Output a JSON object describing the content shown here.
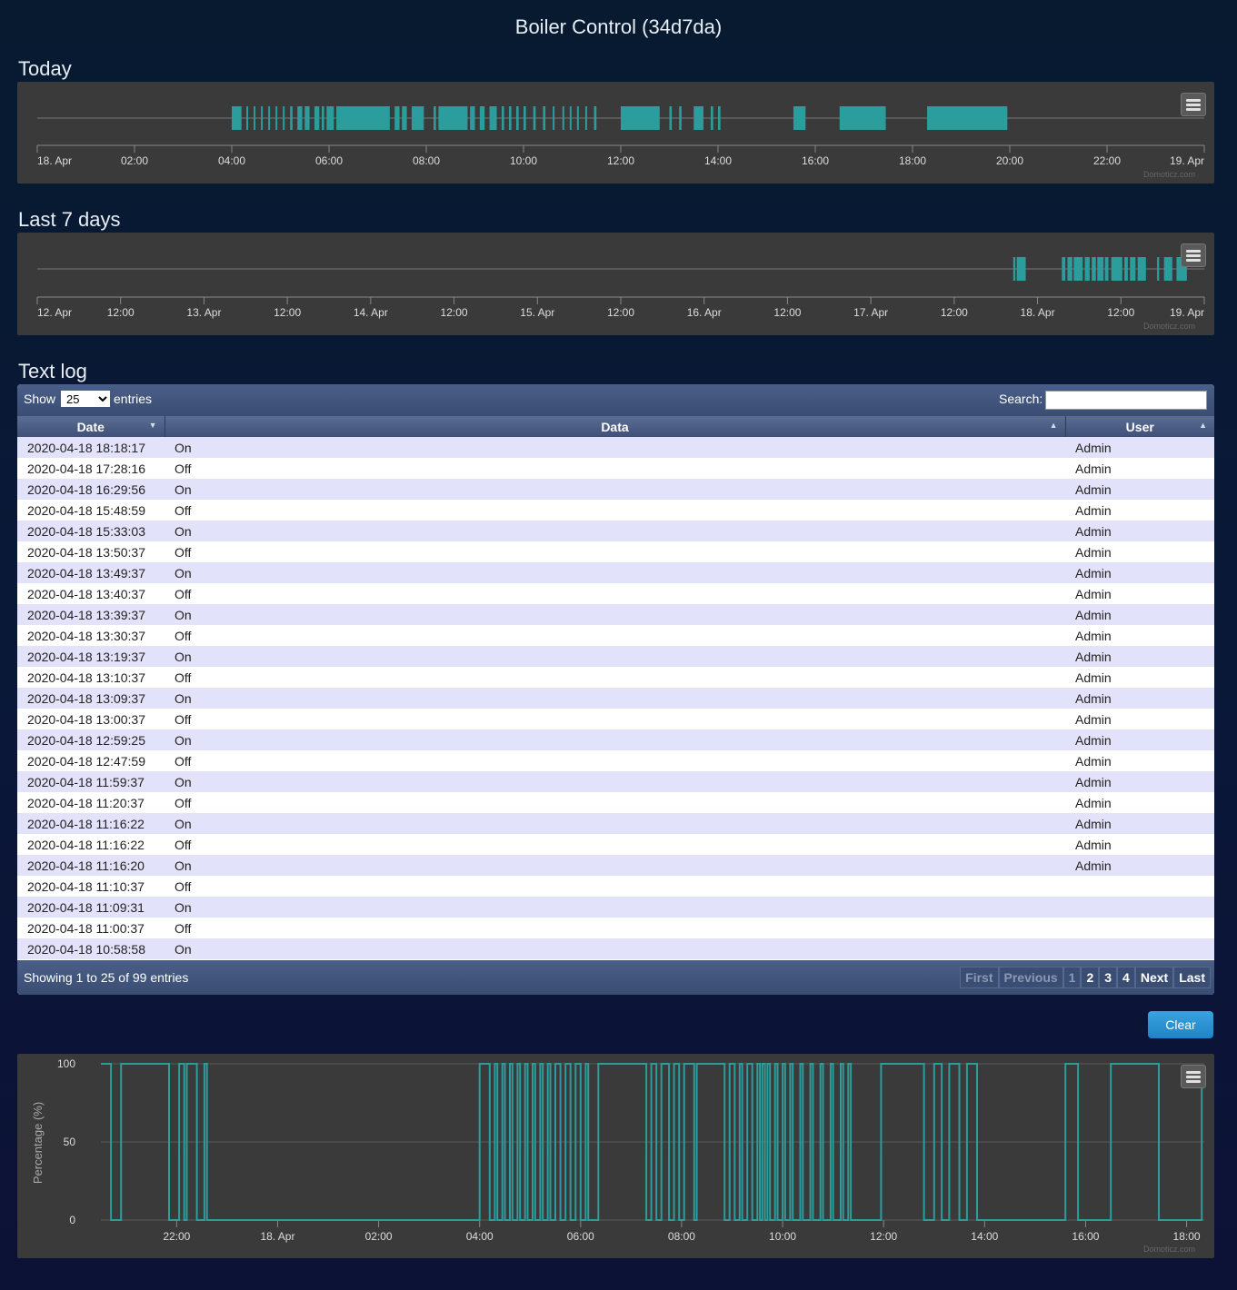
{
  "page": {
    "title": "Boiler Control (34d7da)"
  },
  "sections": {
    "today": "Today",
    "last7": "Last 7 days",
    "textlog": "Text log"
  },
  "colors": {
    "series": "#2a9d9c",
    "chart_bg": "#3a3a3a",
    "header_bar": "#3f5178"
  },
  "chart_data": [
    {
      "type": "bar",
      "name": "today-timeline",
      "xlabel": "",
      "ylabel": "",
      "x_ticks": [
        "18. Apr",
        "02:00",
        "04:00",
        "06:00",
        "08:00",
        "10:00",
        "12:00",
        "14:00",
        "16:00",
        "18:00",
        "20:00",
        "22:00",
        "19. Apr"
      ],
      "x_range_hours": [
        0,
        24
      ],
      "on_intervals_hours": [
        [
          4.0,
          4.2
        ],
        [
          4.3,
          4.33
        ],
        [
          4.45,
          4.48
        ],
        [
          4.6,
          4.63
        ],
        [
          4.75,
          4.78
        ],
        [
          4.9,
          4.93
        ],
        [
          5.05,
          5.08
        ],
        [
          5.2,
          5.25
        ],
        [
          5.35,
          5.45
        ],
        [
          5.5,
          5.6
        ],
        [
          5.7,
          5.8
        ],
        [
          5.85,
          5.9
        ],
        [
          5.95,
          6.1
        ],
        [
          6.15,
          7.25
        ],
        [
          7.35,
          7.45
        ],
        [
          7.5,
          7.6
        ],
        [
          7.7,
          7.95
        ],
        [
          8.15,
          8.2
        ],
        [
          8.25,
          8.85
        ],
        [
          8.9,
          9.0
        ],
        [
          9.1,
          9.2
        ],
        [
          9.3,
          9.45
        ],
        [
          9.55,
          9.6
        ],
        [
          9.7,
          9.75
        ],
        [
          9.85,
          9.9
        ],
        [
          10.0,
          10.05
        ],
        [
          10.2,
          10.25
        ],
        [
          10.4,
          10.45
        ],
        [
          10.6,
          10.63
        ],
        [
          10.8,
          10.83
        ],
        [
          10.95,
          10.98
        ],
        [
          11.1,
          11.13
        ],
        [
          11.27,
          11.3
        ],
        [
          11.45,
          11.5
        ],
        [
          12.0,
          12.8
        ],
        [
          13.0,
          13.05
        ],
        [
          13.2,
          13.25
        ],
        [
          13.5,
          13.7
        ],
        [
          13.85,
          13.9
        ],
        [
          14.0,
          14.05
        ],
        [
          15.55,
          15.8
        ],
        [
          16.5,
          17.45
        ],
        [
          18.3,
          19.95
        ]
      ]
    },
    {
      "type": "bar",
      "name": "last7-timeline",
      "xlabel": "",
      "ylabel": "",
      "x_ticks": [
        "12. Apr",
        "12:00",
        "13. Apr",
        "12:00",
        "14. Apr",
        "12:00",
        "15. Apr",
        "12:00",
        "16. Apr",
        "12:00",
        "17. Apr",
        "12:00",
        "18. Apr",
        "12:00",
        "19. Apr"
      ],
      "x_range_hours": [
        0,
        168
      ],
      "on_intervals_hours": [
        [
          140.5,
          140.8
        ],
        [
          141.0,
          142.3
        ],
        [
          147.5,
          148.0
        ],
        [
          148.3,
          149.0
        ],
        [
          149.2,
          150.5
        ],
        [
          150.8,
          151.5
        ],
        [
          151.8,
          152.4
        ],
        [
          152.6,
          153.5
        ],
        [
          153.7,
          154.2
        ],
        [
          154.6,
          156.2
        ],
        [
          156.5,
          157.0
        ],
        [
          157.3,
          158.1
        ],
        [
          158.4,
          159.6
        ],
        [
          161.2,
          161.5
        ],
        [
          162.2,
          163.4
        ],
        [
          164.0,
          165.5
        ]
      ]
    },
    {
      "type": "line",
      "name": "percentage-history",
      "xlabel": "",
      "ylabel": "Percentage (%)",
      "ylim": [
        0,
        100
      ],
      "y_ticks": [
        0,
        50,
        100
      ],
      "x_ticks": [
        "22:00",
        "18. Apr",
        "02:00",
        "04:00",
        "06:00",
        "08:00",
        "10:00",
        "12:00",
        "14:00",
        "16:00",
        "18:00"
      ],
      "x_range_hours": [
        -3.5,
        18.35
      ],
      "series": [
        {
          "values_hours_step": [
            [
              -3.5,
              100
            ],
            [
              -3.3,
              100
            ],
            [
              -3.3,
              0
            ],
            [
              -3.1,
              0
            ],
            [
              -3.1,
              100
            ],
            [
              -2.15,
              100
            ],
            [
              -2.15,
              0
            ],
            [
              -1.95,
              0
            ],
            [
              -1.95,
              100
            ],
            [
              -1.85,
              100
            ],
            [
              -1.85,
              0
            ],
            [
              -1.8,
              0
            ],
            [
              -1.8,
              100
            ],
            [
              -1.6,
              100
            ],
            [
              -1.6,
              0
            ],
            [
              -1.45,
              0
            ],
            [
              -1.45,
              100
            ],
            [
              -1.4,
              100
            ],
            [
              -1.4,
              0
            ],
            [
              4.0,
              0
            ],
            [
              4.0,
              100
            ],
            [
              4.2,
              100
            ],
            [
              4.2,
              0
            ],
            [
              4.3,
              0
            ],
            [
              4.3,
              100
            ],
            [
              4.35,
              100
            ],
            [
              4.35,
              0
            ],
            [
              4.45,
              0
            ],
            [
              4.45,
              100
            ],
            [
              4.5,
              100
            ],
            [
              4.5,
              0
            ],
            [
              4.6,
              0
            ],
            [
              4.6,
              100
            ],
            [
              4.65,
              100
            ],
            [
              4.65,
              0
            ],
            [
              4.75,
              0
            ],
            [
              4.75,
              100
            ],
            [
              4.8,
              100
            ],
            [
              4.8,
              0
            ],
            [
              4.9,
              0
            ],
            [
              4.9,
              100
            ],
            [
              4.95,
              100
            ],
            [
              4.95,
              0
            ],
            [
              5.05,
              0
            ],
            [
              5.05,
              100
            ],
            [
              5.1,
              100
            ],
            [
              5.1,
              0
            ],
            [
              5.2,
              0
            ],
            [
              5.2,
              100
            ],
            [
              5.25,
              100
            ],
            [
              5.25,
              0
            ],
            [
              5.35,
              0
            ],
            [
              5.35,
              100
            ],
            [
              5.4,
              100
            ],
            [
              5.4,
              0
            ],
            [
              5.5,
              0
            ],
            [
              5.5,
              100
            ],
            [
              5.6,
              100
            ],
            [
              5.6,
              0
            ],
            [
              5.7,
              0
            ],
            [
              5.7,
              100
            ],
            [
              5.8,
              100
            ],
            [
              5.8,
              0
            ],
            [
              5.9,
              0
            ],
            [
              5.9,
              100
            ],
            [
              6.0,
              100
            ],
            [
              6.0,
              0
            ],
            [
              6.1,
              0
            ],
            [
              6.1,
              100
            ],
            [
              6.15,
              100
            ],
            [
              6.15,
              0
            ],
            [
              6.35,
              0
            ],
            [
              6.35,
              100
            ],
            [
              7.3,
              100
            ],
            [
              7.3,
              0
            ],
            [
              7.4,
              0
            ],
            [
              7.4,
              100
            ],
            [
              7.5,
              100
            ],
            [
              7.5,
              0
            ],
            [
              7.6,
              0
            ],
            [
              7.6,
              100
            ],
            [
              7.75,
              100
            ],
            [
              7.75,
              0
            ],
            [
              7.85,
              0
            ],
            [
              7.85,
              100
            ],
            [
              7.95,
              100
            ],
            [
              7.95,
              0
            ],
            [
              8.05,
              0
            ],
            [
              8.05,
              100
            ],
            [
              8.25,
              100
            ],
            [
              8.25,
              0
            ],
            [
              8.3,
              0
            ],
            [
              8.3,
              100
            ],
            [
              8.85,
              100
            ],
            [
              8.85,
              0
            ],
            [
              8.95,
              0
            ],
            [
              8.95,
              100
            ],
            [
              9.05,
              100
            ],
            [
              9.05,
              0
            ],
            [
              9.15,
              0
            ],
            [
              9.15,
              100
            ],
            [
              9.2,
              100
            ],
            [
              9.2,
              0
            ],
            [
              9.3,
              0
            ],
            [
              9.3,
              100
            ],
            [
              9.4,
              100
            ],
            [
              9.4,
              0
            ],
            [
              9.5,
              0
            ],
            [
              9.5,
              100
            ],
            [
              9.55,
              100
            ],
            [
              9.55,
              0
            ],
            [
              9.6,
              0
            ],
            [
              9.6,
              100
            ],
            [
              9.65,
              100
            ],
            [
              9.65,
              0
            ],
            [
              9.7,
              0
            ],
            [
              9.7,
              100
            ],
            [
              9.75,
              100
            ],
            [
              9.75,
              0
            ],
            [
              9.85,
              0
            ],
            [
              9.85,
              100
            ],
            [
              9.9,
              100
            ],
            [
              9.9,
              0
            ],
            [
              10.0,
              0
            ],
            [
              10.0,
              100
            ],
            [
              10.05,
              100
            ],
            [
              10.05,
              0
            ],
            [
              10.15,
              0
            ],
            [
              10.15,
              100
            ],
            [
              10.2,
              100
            ],
            [
              10.2,
              0
            ],
            [
              10.35,
              0
            ],
            [
              10.35,
              100
            ],
            [
              10.4,
              100
            ],
            [
              10.4,
              0
            ],
            [
              10.55,
              0
            ],
            [
              10.55,
              100
            ],
            [
              10.6,
              100
            ],
            [
              10.6,
              0
            ],
            [
              10.75,
              0
            ],
            [
              10.75,
              100
            ],
            [
              10.8,
              100
            ],
            [
              10.8,
              0
            ],
            [
              10.95,
              0
            ],
            [
              10.95,
              100
            ],
            [
              11.0,
              100
            ],
            [
              11.0,
              0
            ],
            [
              11.15,
              0
            ],
            [
              11.15,
              100
            ],
            [
              11.2,
              100
            ],
            [
              11.2,
              0
            ],
            [
              11.3,
              0
            ],
            [
              11.3,
              100
            ],
            [
              11.35,
              100
            ],
            [
              11.35,
              0
            ],
            [
              11.95,
              0
            ],
            [
              11.95,
              100
            ],
            [
              12.8,
              100
            ],
            [
              12.8,
              0
            ],
            [
              13.0,
              0
            ],
            [
              13.0,
              100
            ],
            [
              13.15,
              100
            ],
            [
              13.15,
              0
            ],
            [
              13.3,
              0
            ],
            [
              13.3,
              100
            ],
            [
              13.5,
              100
            ],
            [
              13.5,
              0
            ],
            [
              13.65,
              0
            ],
            [
              13.65,
              100
            ],
            [
              13.85,
              100
            ],
            [
              13.85,
              0
            ],
            [
              15.6,
              0
            ],
            [
              15.6,
              100
            ],
            [
              15.85,
              100
            ],
            [
              15.85,
              0
            ],
            [
              16.5,
              0
            ],
            [
              16.5,
              100
            ],
            [
              17.45,
              100
            ],
            [
              17.45,
              0
            ],
            [
              18.3,
              0
            ],
            [
              18.3,
              85
            ]
          ]
        }
      ]
    }
  ],
  "textlog": {
    "show_label": "Show",
    "page_size": "25",
    "entries_label": "entries",
    "search_label": "Search:",
    "search_value": "",
    "columns": [
      "Date",
      "Data",
      "User"
    ],
    "rows": [
      [
        "2020-04-18 18:18:17",
        "On",
        "Admin"
      ],
      [
        "2020-04-18 17:28:16",
        "Off",
        "Admin"
      ],
      [
        "2020-04-18 16:29:56",
        "On",
        "Admin"
      ],
      [
        "2020-04-18 15:48:59",
        "Off",
        "Admin"
      ],
      [
        "2020-04-18 15:33:03",
        "On",
        "Admin"
      ],
      [
        "2020-04-18 13:50:37",
        "Off",
        "Admin"
      ],
      [
        "2020-04-18 13:49:37",
        "On",
        "Admin"
      ],
      [
        "2020-04-18 13:40:37",
        "Off",
        "Admin"
      ],
      [
        "2020-04-18 13:39:37",
        "On",
        "Admin"
      ],
      [
        "2020-04-18 13:30:37",
        "Off",
        "Admin"
      ],
      [
        "2020-04-18 13:19:37",
        "On",
        "Admin"
      ],
      [
        "2020-04-18 13:10:37",
        "Off",
        "Admin"
      ],
      [
        "2020-04-18 13:09:37",
        "On",
        "Admin"
      ],
      [
        "2020-04-18 13:00:37",
        "Off",
        "Admin"
      ],
      [
        "2020-04-18 12:59:25",
        "On",
        "Admin"
      ],
      [
        "2020-04-18 12:47:59",
        "Off",
        "Admin"
      ],
      [
        "2020-04-18 11:59:37",
        "On",
        "Admin"
      ],
      [
        "2020-04-18 11:20:37",
        "Off",
        "Admin"
      ],
      [
        "2020-04-18 11:16:22",
        "On",
        "Admin"
      ],
      [
        "2020-04-18 11:16:22",
        "Off",
        "Admin"
      ],
      [
        "2020-04-18 11:16:20",
        "On",
        "Admin"
      ],
      [
        "2020-04-18 11:10:37",
        "Off",
        ""
      ],
      [
        "2020-04-18 11:09:31",
        "On",
        ""
      ],
      [
        "2020-04-18 11:00:37",
        "Off",
        ""
      ],
      [
        "2020-04-18 10:58:58",
        "On",
        ""
      ]
    ],
    "info": "Showing 1 to 25 of 99 entries",
    "pager": {
      "first": "First",
      "previous": "Previous",
      "pages": [
        "1",
        "2",
        "3",
        "4"
      ],
      "next": "Next",
      "last": "Last"
    }
  },
  "clear_label": "Clear",
  "credit": "Domoticz.com",
  "icons": {
    "chart_menu": "hamburger-menu-icon",
    "sort_desc": "triangle-down-icon",
    "sort_asc": "triangle-up-icon"
  }
}
